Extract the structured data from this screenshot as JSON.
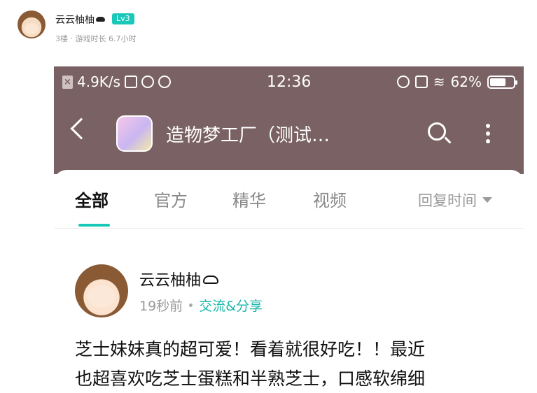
{
  "outer": {
    "username": "云云柚柚",
    "level": "Lv3",
    "floor": "3楼",
    "playtime_label": "游戏时长 6.7小时"
  },
  "status_bar": {
    "speed": "4.9K/s",
    "time": "12:36",
    "battery": "62%"
  },
  "app_bar": {
    "title": "造物梦工厂（测试…"
  },
  "tabs": [
    {
      "label": "全部",
      "active": true
    },
    {
      "label": "官方",
      "active": false
    },
    {
      "label": "精华",
      "active": false
    },
    {
      "label": "视频",
      "active": false
    }
  ],
  "sort": {
    "label": "回复时间"
  },
  "post": {
    "author": "云云柚柚",
    "time": "19秒前",
    "category": "交流&分享",
    "lines": [
      "芝士妹妹真的超可爱！看着就很好吃！！最近",
      "也超喜欢吃芝士蛋糕和半熟芝士，口感软绵细"
    ]
  },
  "colors": {
    "header_bg": "#7a6163",
    "accent": "#19c8b8"
  }
}
